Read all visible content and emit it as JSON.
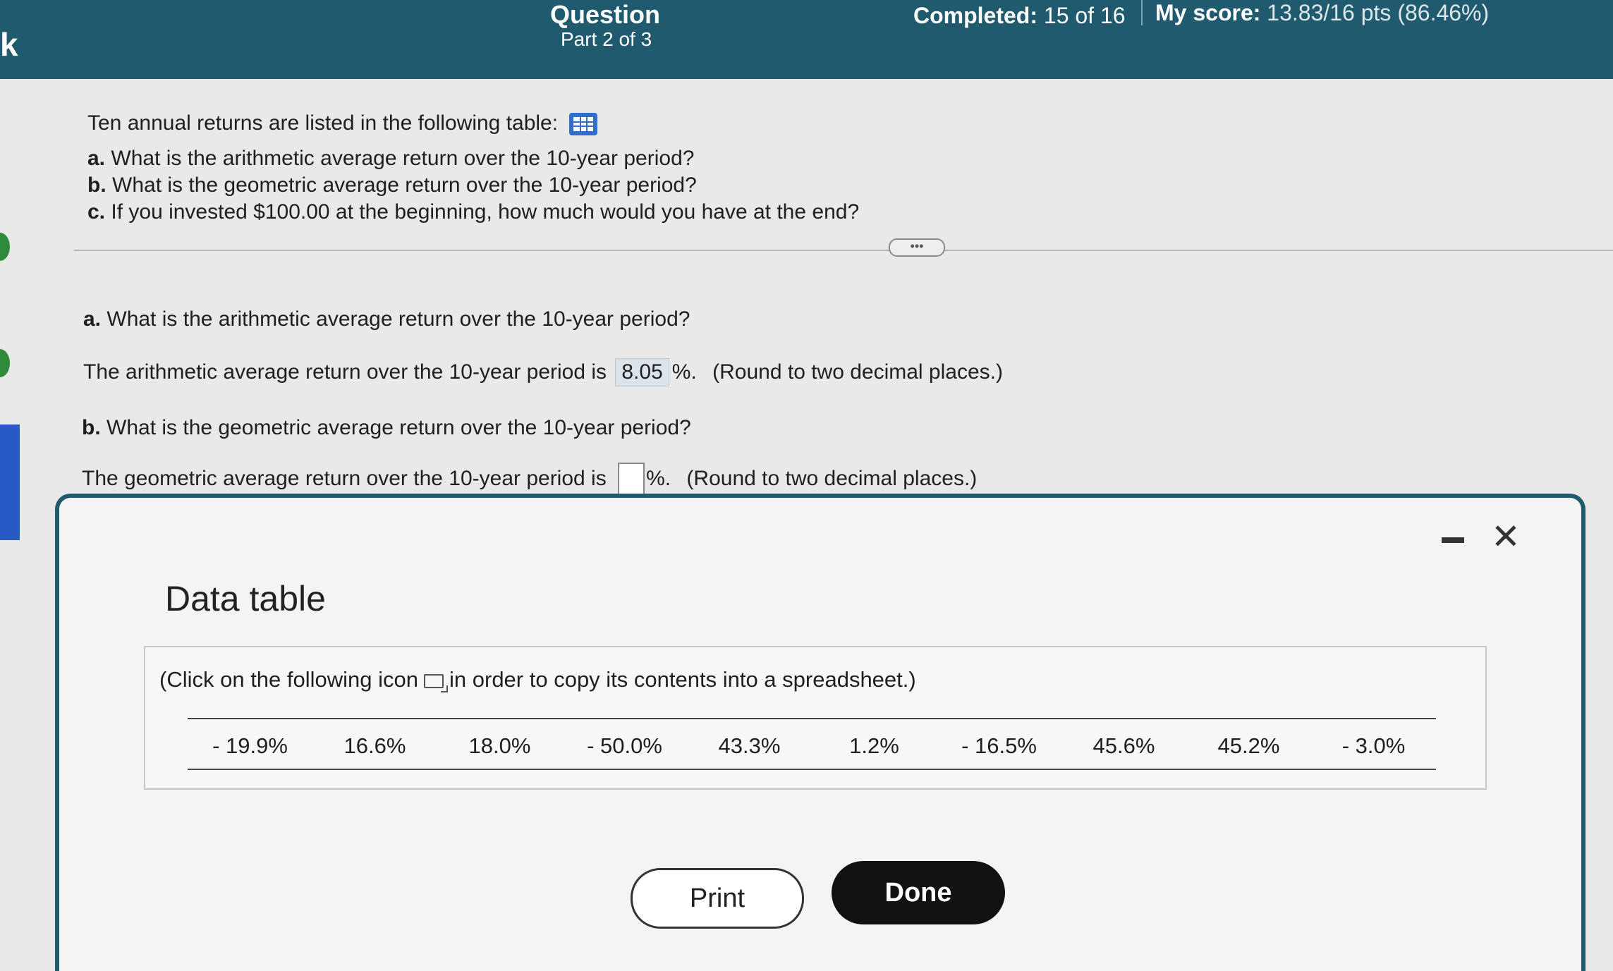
{
  "header": {
    "edge_label": "k",
    "question_title": "Question",
    "question_part": "Part 2 of 3",
    "completed_label": "Completed:",
    "completed_value": "15 of 16",
    "score_label": "My score:",
    "score_value": "13.83/16 pts (86.46%)"
  },
  "question": {
    "intro": "Ten annual returns are listed in the following table:",
    "table_icon": "grid-table-icon",
    "parts": [
      {
        "letter": "a.",
        "text": "What is the arithmetic average return over the 10-year period?"
      },
      {
        "letter": "b.",
        "text": "What is the geometric average return over the 10-year period?"
      },
      {
        "letter": "c.",
        "text": "If you invested $100.00 at the beginning, how much would you have at the end?"
      }
    ],
    "more_label": "•••"
  },
  "answers": {
    "a_prompt_letter": "a.",
    "a_prompt": "What is the arithmetic average return over the 10-year period?",
    "a_stmt": "The arithmetic average return over the 10-year period is",
    "a_value": "8.05",
    "a_suffix": "%.",
    "a_hint": "(Round to two decimal places.)",
    "b_prompt_letter": "b.",
    "b_prompt": "What is the geometric average return over the 10-year period?",
    "b_stmt": "The geometric average return over the 10-year period is",
    "b_value": "",
    "b_suffix": "%.",
    "b_hint": "(Round to two decimal places.)"
  },
  "data_table": {
    "title": "Data table",
    "copy_note_before": "(Click on the following icon",
    "copy_note_after": "in order to copy its contents into a spreadsheet.)",
    "returns": [
      "- 19.9%",
      "16.6%",
      "18.0%",
      "- 50.0%",
      "43.3%",
      "1.2%",
      "- 16.5%",
      "45.6%",
      "45.2%",
      "- 3.0%"
    ],
    "print_label": "Print",
    "done_label": "Done",
    "minimize_icon": "minimize-icon",
    "close_icon": "close-icon"
  },
  "colors": {
    "header_bg": "#1f5a6f",
    "done_bg": "#111111",
    "table_icon": "#2f6fc9"
  }
}
